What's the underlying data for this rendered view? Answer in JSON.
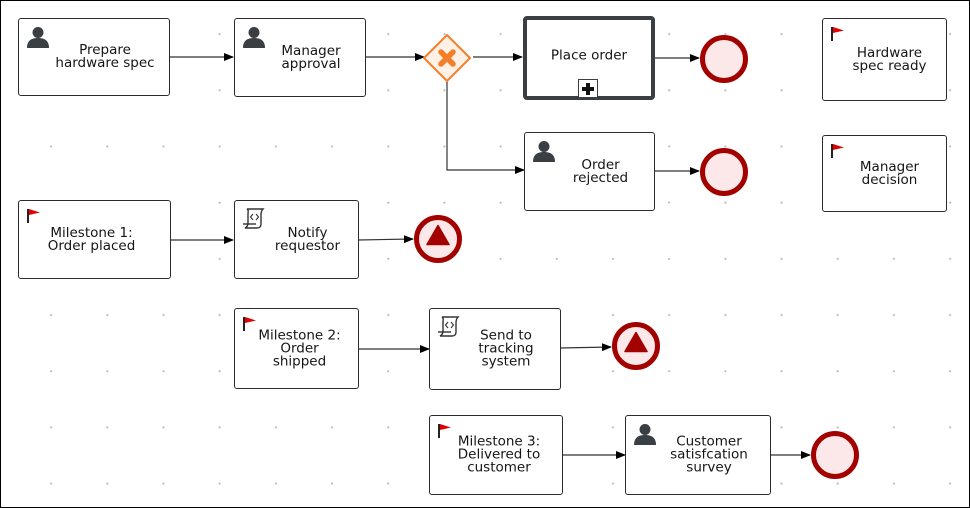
{
  "diagram": {
    "type": "BPMN process",
    "colors": {
      "node_border": "#2b2b2b",
      "end_event_stroke": "#a30000",
      "end_event_fill": "#fce8e8",
      "gateway_stroke": "#f47f2b",
      "gateway_fill": "#fff1e6",
      "milestone_flag": "#e00000",
      "user_icon": "#3a3f44"
    },
    "nodes": {
      "prepare_spec": {
        "label": "Prepare\nhardware spec",
        "kind": "user-task",
        "icon": "user-icon"
      },
      "manager_approval": {
        "label": "Manager\napproval",
        "kind": "user-task",
        "icon": "user-icon"
      },
      "gateway": {
        "kind": "exclusive-gateway",
        "icon": "x-icon"
      },
      "place_order": {
        "label": "Place order",
        "kind": "collapsed-subprocess",
        "icon": "plus-icon"
      },
      "order_rejected": {
        "label": "Order\nrejected",
        "kind": "user-task",
        "icon": "user-icon"
      },
      "hardware_spec_ready": {
        "label": "Hardware\nspec ready",
        "kind": "milestone",
        "icon": "flag-icon"
      },
      "manager_decision": {
        "label": "Manager\ndecision",
        "kind": "milestone",
        "icon": "flag-icon"
      },
      "milestone1": {
        "label": "Milestone 1:\nOrder placed",
        "kind": "milestone",
        "icon": "flag-icon"
      },
      "notify_requestor": {
        "label": "Notify\nrequestor",
        "kind": "script-task",
        "icon": "script-icon"
      },
      "milestone2": {
        "label": "Milestone 2:\nOrder\nshipped",
        "kind": "milestone",
        "icon": "flag-icon"
      },
      "send_tracking": {
        "label": "Send to\ntracking\nsystem",
        "kind": "script-task",
        "icon": "script-icon"
      },
      "milestone3": {
        "label": "Milestone 3:\nDelivered to\ncustomer",
        "kind": "milestone",
        "icon": "flag-icon"
      },
      "survey": {
        "label": "Customer\nsatisfcation\nsurvey",
        "kind": "user-task",
        "icon": "user-icon"
      },
      "end1": {
        "kind": "end-event"
      },
      "end2": {
        "kind": "end-event"
      },
      "end3": {
        "kind": "escalation-end-event",
        "icon": "escalation-icon"
      },
      "end4": {
        "kind": "escalation-end-event",
        "icon": "escalation-icon"
      },
      "end5": {
        "kind": "end-event"
      }
    },
    "flows": [
      [
        "prepare_spec",
        "manager_approval"
      ],
      [
        "manager_approval",
        "gateway"
      ],
      [
        "gateway",
        "place_order"
      ],
      [
        "gateway",
        "order_rejected"
      ],
      [
        "place_order",
        "end1"
      ],
      [
        "order_rejected",
        "end2"
      ],
      [
        "milestone1",
        "notify_requestor"
      ],
      [
        "notify_requestor",
        "end3"
      ],
      [
        "milestone2",
        "send_tracking"
      ],
      [
        "send_tracking",
        "end4"
      ],
      [
        "milestone3",
        "survey"
      ],
      [
        "survey",
        "end5"
      ]
    ]
  }
}
